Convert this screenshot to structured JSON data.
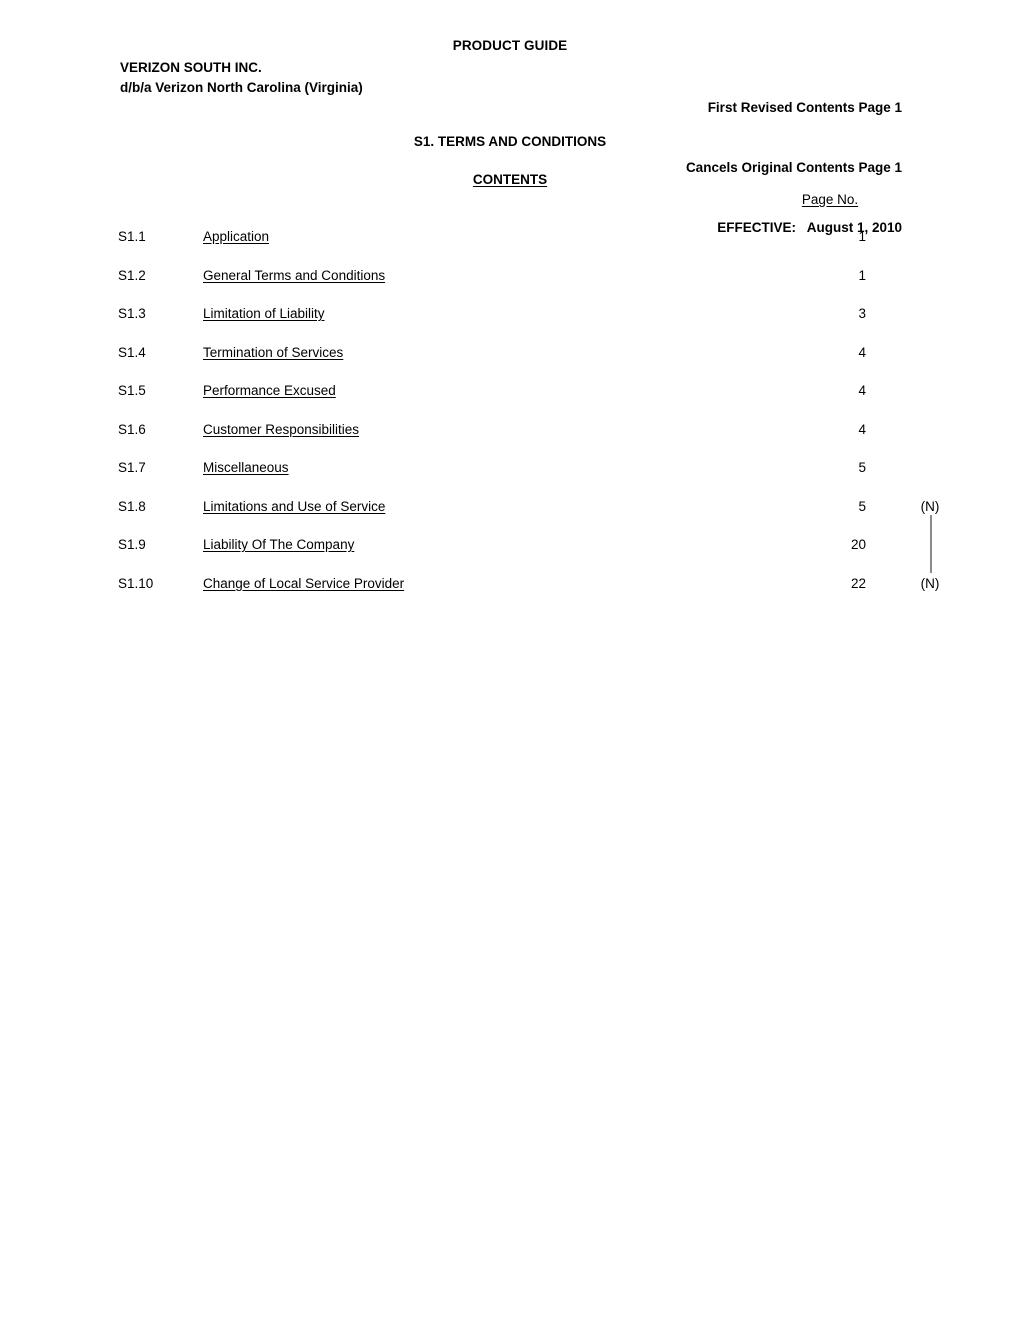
{
  "header": {
    "doc_title": "PRODUCT GUIDE",
    "company_line1": "VERIZON SOUTH INC.",
    "company_line2": "d/b/a Verizon North Carolina (Virginia)",
    "revision_line1": "First Revised Contents Page 1",
    "revision_line2": "Cancels Original Contents Page 1",
    "revision_line3": "EFFECTIVE:   August 1, 2010"
  },
  "section": {
    "title": "S1.  TERMS AND CONDITIONS",
    "contents_heading": "CONTENTS",
    "page_no_heading": "Page No."
  },
  "toc": {
    "rows": [
      {
        "number": "S1.1",
        "title": "Application",
        "page": "1",
        "marker": ""
      },
      {
        "number": "S1.2",
        "title": "General Terms and Conditions",
        "page": "1",
        "marker": ""
      },
      {
        "number": "S1.3",
        "title": "Limitation of Liability",
        "page": "3",
        "marker": ""
      },
      {
        "number": "S1.4",
        "title": "Termination of Services",
        "page": "4",
        "marker": ""
      },
      {
        "number": "S1.5",
        "title": "Performance Excused",
        "page": "4",
        "marker": ""
      },
      {
        "number": "S1.6",
        "title": "Customer Responsibilities",
        "page": "4",
        "marker": ""
      },
      {
        "number": "S1.7",
        "title": "Miscellaneous",
        "page": "5",
        "marker": ""
      },
      {
        "number": "S1.8",
        "title": "Limitations and Use of Service",
        "page": "5",
        "marker": "(N)"
      },
      {
        "number": "S1.9",
        "title": "Liability Of The Company",
        "page": "20",
        "marker": ""
      },
      {
        "number": "S1.10",
        "title": "Change of Local Service Provider",
        "page": "22",
        "marker": "(N)"
      }
    ]
  },
  "colors": {
    "text": "#000000",
    "background": "#ffffff",
    "change_bar": "#8a8a8a"
  }
}
